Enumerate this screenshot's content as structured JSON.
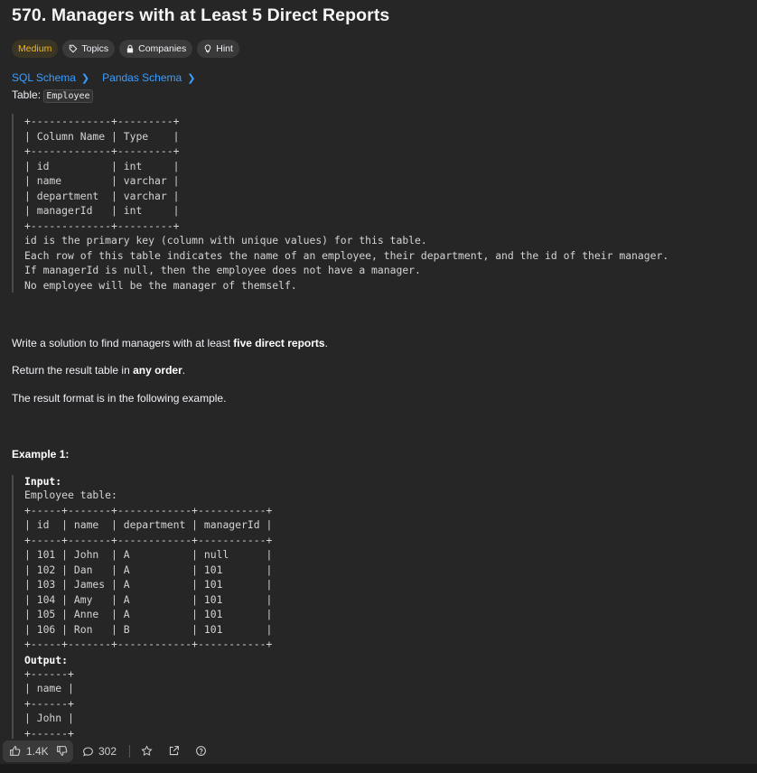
{
  "problem": {
    "title": "570. Managers with at Least 5 Direct Reports",
    "difficulty": "Medium",
    "tags": [
      "Topics",
      "Companies",
      "Hint"
    ]
  },
  "schema_links": [
    "SQL Schema",
    "Pandas Schema"
  ],
  "table_intro": {
    "prefix": "Table: ",
    "name": "Employee"
  },
  "schema_block": "+-------------+---------+\n| Column Name | Type    |\n+-------------+---------+\n| id          | int     |\n| name        | varchar |\n| department  | varchar |\n| managerId   | int     |\n+-------------+---------+\nid is the primary key (column with unique values) for this table.\nEach row of this table indicates the name of an employee, their department, and the id of their manager.\nIf managerId is null, then the employee does not have a manager.\nNo employee will be the manager of themself.",
  "description": {
    "line1_pre": "Write a solution to find managers with at least ",
    "line1_bold": "five direct reports",
    "line1_post": ".",
    "line2_pre": "Return the result table in ",
    "line2_bold": "any order",
    "line2_post": ".",
    "line3": "The result format is in the following example."
  },
  "example": {
    "title": "Example 1:",
    "input_label": "Input:",
    "input_block": "Employee table:\n+-----+-------+------------+-----------+\n| id  | name  | department | managerId |\n+-----+-------+------------+-----------+\n| 101 | John  | A          | null      |\n| 102 | Dan   | A          | 101       |\n| 103 | James | A          | 101       |\n| 104 | Amy   | A          | 101       |\n| 105 | Anne  | A          | 101       |\n| 106 | Ron   | B          | 101       |\n+-----+-------+------------+-----------+",
    "output_label": "Output:",
    "output_block": "+------+\n| name |\n+------+\n| John |\n+------+"
  },
  "footer": {
    "likes": "1.4K",
    "comments": "302"
  },
  "colors": {
    "background": "#262626",
    "medium": "#ffb800",
    "link": "#3b9eff"
  }
}
